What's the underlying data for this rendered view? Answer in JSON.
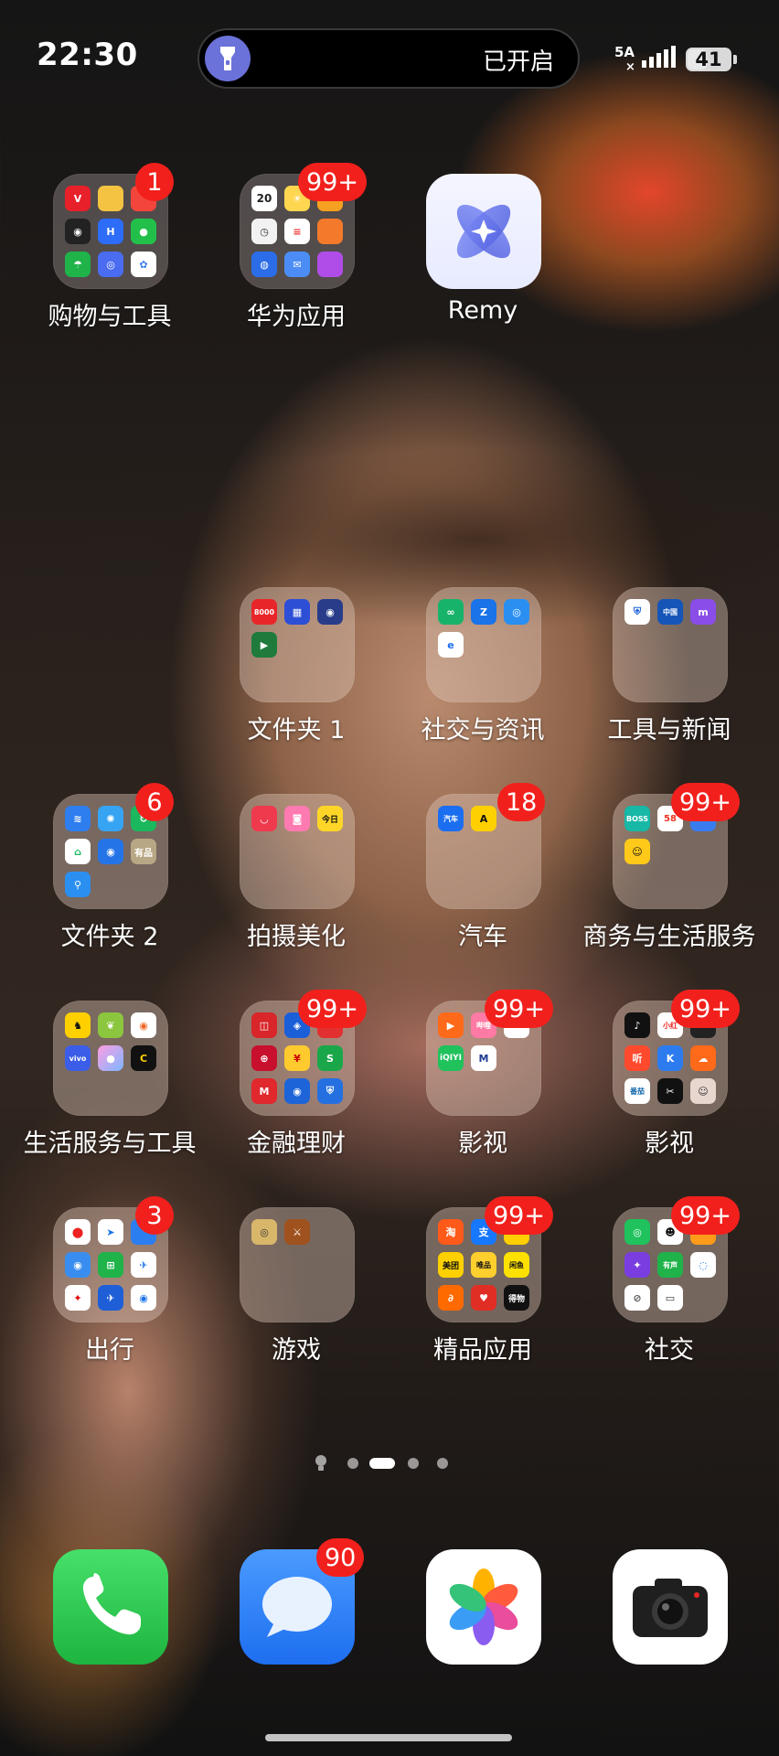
{
  "status_bar": {
    "time": "22:30",
    "flashlight_status": "已开启",
    "network": "5A",
    "battery": "41"
  },
  "apps": [
    {
      "label": "购物与工具",
      "badge": "1"
    },
    {
      "label": "华为应用",
      "badge": "99+"
    },
    {
      "label": "Remy",
      "badge": ""
    },
    {
      "label": "文件夹 1",
      "badge": ""
    },
    {
      "label": "社交与资讯",
      "badge": ""
    },
    {
      "label": "工具与新闻",
      "badge": ""
    },
    {
      "label": "文件夹 2",
      "badge": "6"
    },
    {
      "label": "拍摄美化",
      "badge": ""
    },
    {
      "label": "汽车",
      "badge": "18"
    },
    {
      "label": "商务与生活服务",
      "badge": "99+"
    },
    {
      "label": "生活服务与工具",
      "badge": ""
    },
    {
      "label": "金融理财",
      "badge": "99+"
    },
    {
      "label": "影视",
      "badge": "99+"
    },
    {
      "label": "影视",
      "badge": "99+"
    },
    {
      "label": "出行",
      "badge": "3"
    },
    {
      "label": "游戏",
      "badge": ""
    },
    {
      "label": "精品应用",
      "badge": "99+"
    },
    {
      "label": "社交",
      "badge": "99+"
    }
  ],
  "dock": {
    "messages_badge": "90"
  },
  "page_indicator": {
    "total_pages": 4,
    "current_page": 2
  }
}
